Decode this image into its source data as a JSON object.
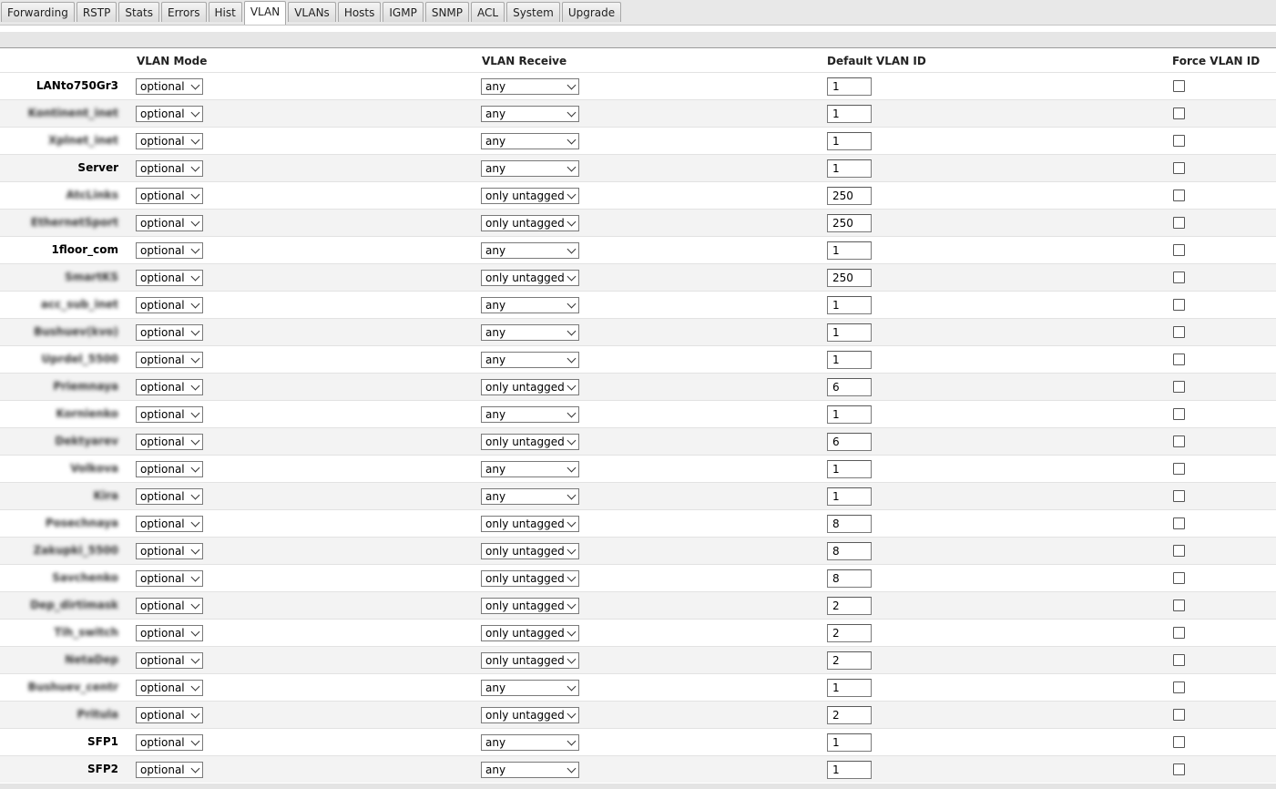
{
  "tabs": [
    "Forwarding",
    "RSTP",
    "Stats",
    "Errors",
    "Hist",
    "VLAN",
    "VLANs",
    "Hosts",
    "IGMP",
    "SNMP",
    "ACL",
    "System",
    "Upgrade"
  ],
  "active_tab": "VLAN",
  "columns": {
    "vlan_mode": "VLAN Mode",
    "vlan_receive": "VLAN Receive",
    "default_vlan_id": "Default VLAN ID",
    "force_vlan_id": "Force VLAN ID"
  },
  "rows": [
    {
      "port": "LANto750Gr3",
      "blurred": false,
      "mode": "optional",
      "receive": "any",
      "vlan_id": "1",
      "force": false
    },
    {
      "port": "Kontinent_inet",
      "blurred": true,
      "mode": "optional",
      "receive": "any",
      "vlan_id": "1",
      "force": false
    },
    {
      "port": "Xplnet_inet",
      "blurred": true,
      "mode": "optional",
      "receive": "any",
      "vlan_id": "1",
      "force": false
    },
    {
      "port": "Server",
      "blurred": false,
      "mode": "optional",
      "receive": "any",
      "vlan_id": "1",
      "force": false
    },
    {
      "port": "AtcLinks",
      "blurred": true,
      "mode": "optional",
      "receive": "only untagged",
      "vlan_id": "250",
      "force": false
    },
    {
      "port": "EthernetSport",
      "blurred": true,
      "mode": "optional",
      "receive": "only untagged",
      "vlan_id": "250",
      "force": false
    },
    {
      "port": "1floor_com",
      "blurred": false,
      "mode": "optional",
      "receive": "any",
      "vlan_id": "1",
      "force": false
    },
    {
      "port": "SmartKS",
      "blurred": true,
      "mode": "optional",
      "receive": "only untagged",
      "vlan_id": "250",
      "force": false
    },
    {
      "port": "acc_sub_inet",
      "blurred": true,
      "mode": "optional",
      "receive": "any",
      "vlan_id": "1",
      "force": false
    },
    {
      "port": "Bushuev(kvo)",
      "blurred": true,
      "mode": "optional",
      "receive": "any",
      "vlan_id": "1",
      "force": false
    },
    {
      "port": "Uprdel_5500",
      "blurred": true,
      "mode": "optional",
      "receive": "any",
      "vlan_id": "1",
      "force": false
    },
    {
      "port": "Priemnaya",
      "blurred": true,
      "mode": "optional",
      "receive": "only untagged",
      "vlan_id": "6",
      "force": false
    },
    {
      "port": "Kornienko",
      "blurred": true,
      "mode": "optional",
      "receive": "any",
      "vlan_id": "1",
      "force": false
    },
    {
      "port": "Dektyarev",
      "blurred": true,
      "mode": "optional",
      "receive": "only untagged",
      "vlan_id": "6",
      "force": false
    },
    {
      "port": "Volkova",
      "blurred": true,
      "mode": "optional",
      "receive": "any",
      "vlan_id": "1",
      "force": false
    },
    {
      "port": "Kira",
      "blurred": true,
      "mode": "optional",
      "receive": "any",
      "vlan_id": "1",
      "force": false
    },
    {
      "port": "Posechnaya",
      "blurred": true,
      "mode": "optional",
      "receive": "only untagged",
      "vlan_id": "8",
      "force": false
    },
    {
      "port": "Zakupki_5500",
      "blurred": true,
      "mode": "optional",
      "receive": "only untagged",
      "vlan_id": "8",
      "force": false
    },
    {
      "port": "Savchenko",
      "blurred": true,
      "mode": "optional",
      "receive": "only untagged",
      "vlan_id": "8",
      "force": false
    },
    {
      "port": "Dep_dirtimask",
      "blurred": true,
      "mode": "optional",
      "receive": "only untagged",
      "vlan_id": "2",
      "force": false
    },
    {
      "port": "Tih_switch",
      "blurred": true,
      "mode": "optional",
      "receive": "only untagged",
      "vlan_id": "2",
      "force": false
    },
    {
      "port": "NetaDep",
      "blurred": true,
      "mode": "optional",
      "receive": "only untagged",
      "vlan_id": "2",
      "force": false
    },
    {
      "port": "Bushuev_centr",
      "blurred": true,
      "mode": "optional",
      "receive": "any",
      "vlan_id": "1",
      "force": false
    },
    {
      "port": "Pritula",
      "blurred": true,
      "mode": "optional",
      "receive": "only untagged",
      "vlan_id": "2",
      "force": false
    },
    {
      "port": "SFP1",
      "blurred": false,
      "mode": "optional",
      "receive": "any",
      "vlan_id": "1",
      "force": false
    },
    {
      "port": "SFP2",
      "blurred": false,
      "mode": "optional",
      "receive": "any",
      "vlan_id": "1",
      "force": false
    }
  ]
}
